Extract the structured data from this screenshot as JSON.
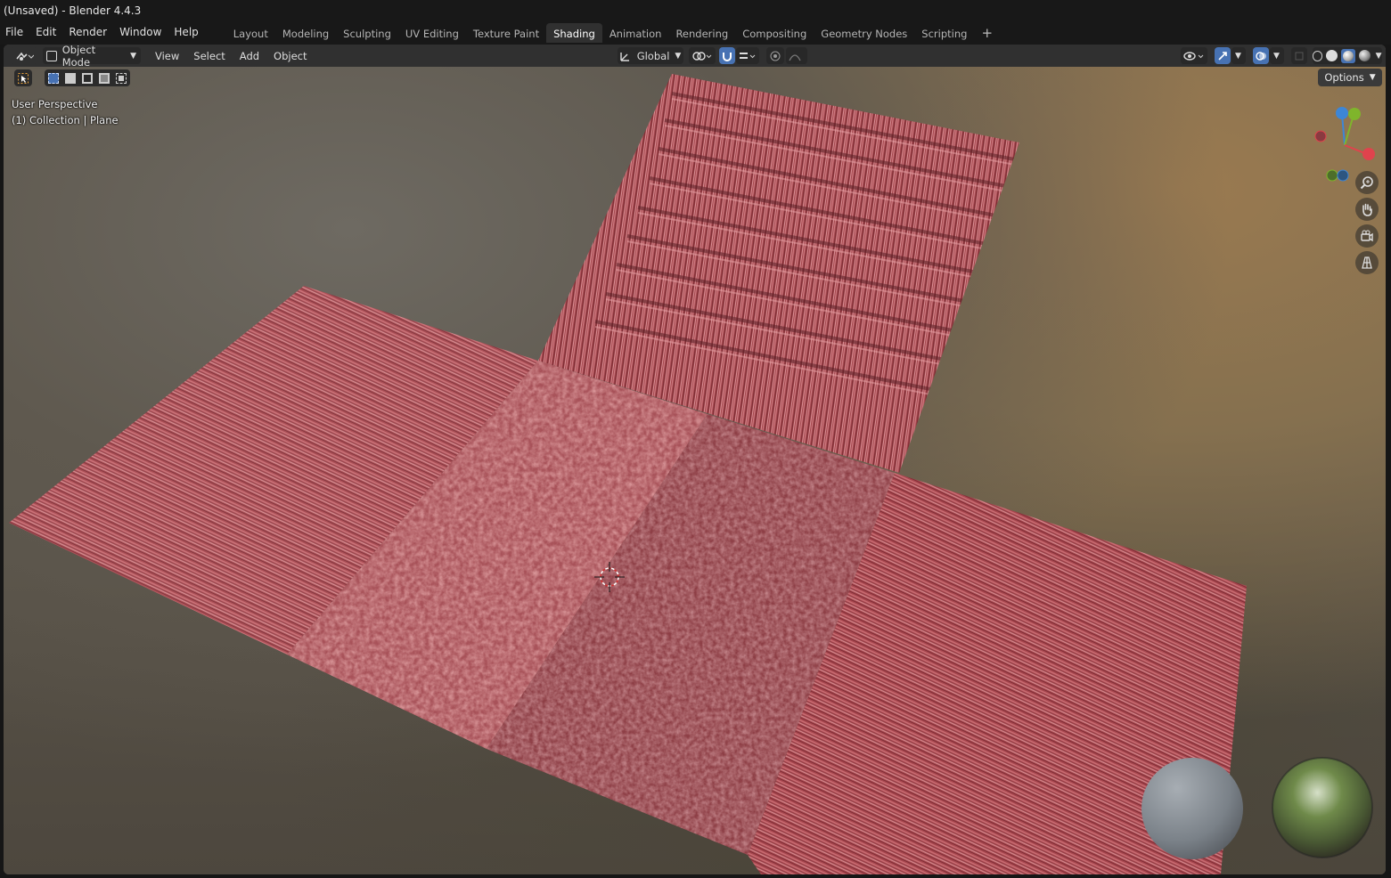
{
  "window_title": "(Unsaved) - Blender 4.4.3",
  "menu": [
    "File",
    "Edit",
    "Render",
    "Window",
    "Help"
  ],
  "workspaces": [
    "Layout",
    "Modeling",
    "Sculpting",
    "UV Editing",
    "Texture Paint",
    "Shading",
    "Animation",
    "Rendering",
    "Compositing",
    "Geometry Nodes",
    "Scripting"
  ],
  "active_workspace": "Shading",
  "header": {
    "mode": "Object Mode",
    "menus": [
      "View",
      "Select",
      "Add",
      "Object"
    ],
    "transform_orientation": "Global"
  },
  "viewport": {
    "view_name": "User Perspective",
    "collection_info": "(1) Collection | Plane",
    "options_label": "Options",
    "gizmo_axes": {
      "z": "Z",
      "y": "Y",
      "x": "X"
    }
  },
  "colors": {
    "accent": "#4772b3",
    "axis_x": "#e0434d",
    "axis_y": "#7fb52b",
    "axis_z": "#3d86d6",
    "material": "#b85a5e"
  }
}
